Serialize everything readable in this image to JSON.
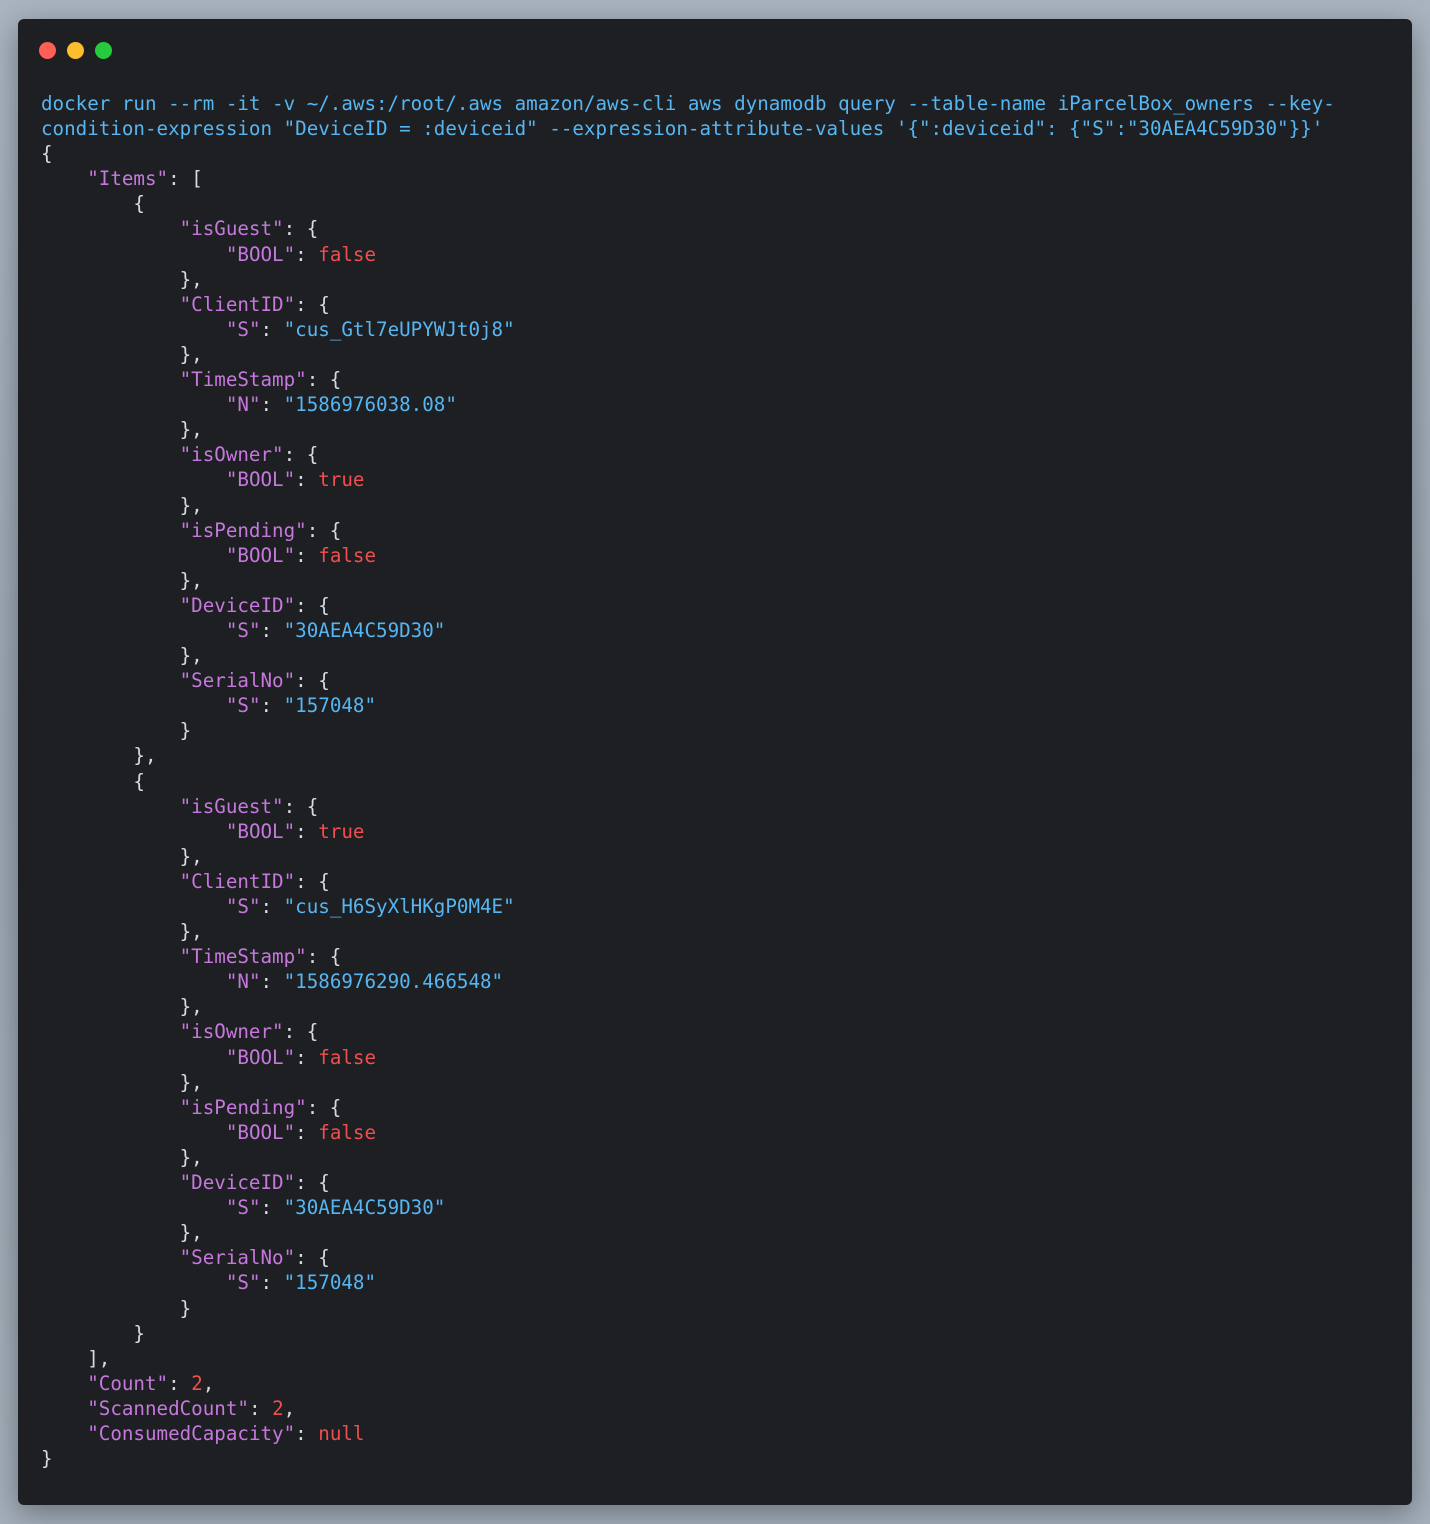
{
  "window": {
    "controls": [
      "close",
      "minimize",
      "maximize"
    ],
    "colors": {
      "close": "#ff5f56",
      "minimize": "#ffbd2e",
      "maximize": "#27c93f",
      "background": "#1d1f23"
    }
  },
  "terminal": {
    "command_line_1": "docker run --rm -it -v ~/.aws:/root/.aws amazon/aws-cli aws dynamodb query --table-name iParcelBox_owners --key-",
    "command_line_2": "condition-expression \"DeviceID = :deviceid\" --expression-attribute-values '{\":deviceid\": {\"S\":\"30AEA4C59D30\"}}'",
    "output": {
      "items_key": "\"Items\"",
      "items": [
        {
          "isGuest": {
            "key": "\"isGuest\"",
            "type": "\"BOOL\"",
            "value": "false"
          },
          "ClientID": {
            "key": "\"ClientID\"",
            "type": "\"S\"",
            "value": "\"cus_Gtl7eUPYWJt0j8\""
          },
          "TimeStamp": {
            "key": "\"TimeStamp\"",
            "type": "\"N\"",
            "value": "\"1586976038.08\""
          },
          "isOwner": {
            "key": "\"isOwner\"",
            "type": "\"BOOL\"",
            "value": "true"
          },
          "isPending": {
            "key": "\"isPending\"",
            "type": "\"BOOL\"",
            "value": "false"
          },
          "DeviceID": {
            "key": "\"DeviceID\"",
            "type": "\"S\"",
            "value": "\"30AEA4C59D30\""
          },
          "SerialNo": {
            "key": "\"SerialNo\"",
            "type": "\"S\"",
            "value": "\"157048\""
          }
        },
        {
          "isGuest": {
            "key": "\"isGuest\"",
            "type": "\"BOOL\"",
            "value": "true"
          },
          "ClientID": {
            "key": "\"ClientID\"",
            "type": "\"S\"",
            "value": "\"cus_H6SyXlHKgP0M4E\""
          },
          "TimeStamp": {
            "key": "\"TimeStamp\"",
            "type": "\"N\"",
            "value": "\"1586976290.466548\""
          },
          "isOwner": {
            "key": "\"isOwner\"",
            "type": "\"BOOL\"",
            "value": "false"
          },
          "isPending": {
            "key": "\"isPending\"",
            "type": "\"BOOL\"",
            "value": "false"
          },
          "DeviceID": {
            "key": "\"DeviceID\"",
            "type": "\"S\"",
            "value": "\"30AEA4C59D30\""
          },
          "SerialNo": {
            "key": "\"SerialNo\"",
            "type": "\"S\"",
            "value": "\"157048\""
          }
        }
      ],
      "count_key": "\"Count\"",
      "count": "2",
      "scanned_count_key": "\"ScannedCount\"",
      "scanned_count": "2",
      "consumed_capacity_key": "\"ConsumedCapacity\"",
      "consumed_capacity": "null"
    }
  }
}
